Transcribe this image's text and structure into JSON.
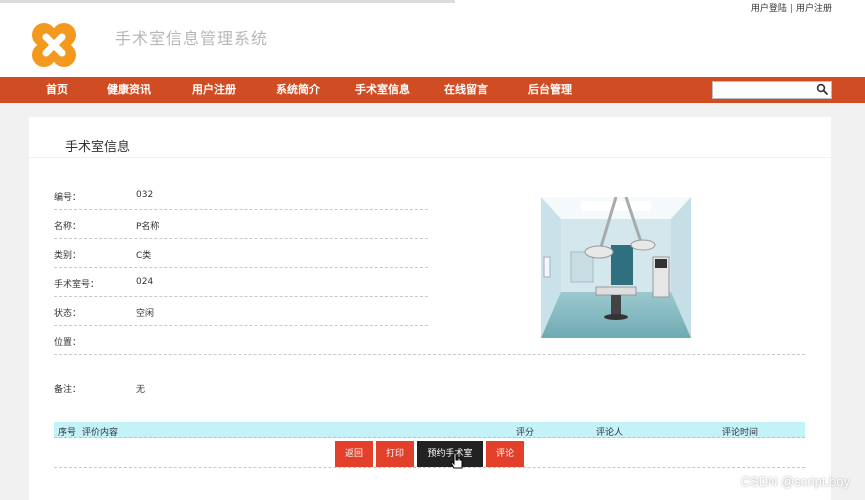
{
  "header": {
    "top_links": {
      "login": "用户登陆",
      "separator": "|",
      "register": "用户注册"
    },
    "site_title": "手术室信息管理系统",
    "logo_icon": "orange-x-logo-icon"
  },
  "nav": {
    "items": [
      {
        "label": "首页"
      },
      {
        "label": "健康资讯"
      },
      {
        "label": "用户注册"
      },
      {
        "label": "系统简介"
      },
      {
        "label": "手术室信息"
      },
      {
        "label": "在线留言"
      },
      {
        "label": "后台管理"
      }
    ],
    "search": {
      "value": "",
      "placeholder": "",
      "icon": "search-icon"
    }
  },
  "panel": {
    "title": "手术室信息",
    "fields": [
      {
        "label": "编号：",
        "value": "032"
      },
      {
        "label": "名称：",
        "value": "P名称"
      },
      {
        "label": "类别：",
        "value": "C类"
      },
      {
        "label": "手术室号：",
        "value": "024"
      },
      {
        "label": "状态：",
        "value": "空闲"
      },
      {
        "label": "位置：",
        "value": ""
      },
      {
        "label": "备注：",
        "value": "无"
      }
    ],
    "comment_table": {
      "headers": {
        "index": "序号",
        "content": "评价内容",
        "score": "评分",
        "reviewer": "评论人",
        "time": "评论时间"
      }
    },
    "buttons": {
      "back": "返回",
      "print": "打印",
      "reserve": "预约手术室",
      "comment": "评论"
    }
  },
  "watermark": "CSDN @script.boy",
  "colors": {
    "nav_bg": "#d04d24",
    "button": "#e2402a",
    "button_dark": "#222222",
    "table_head": "#c3f2f8",
    "page_bg": "#f1f1f1"
  }
}
